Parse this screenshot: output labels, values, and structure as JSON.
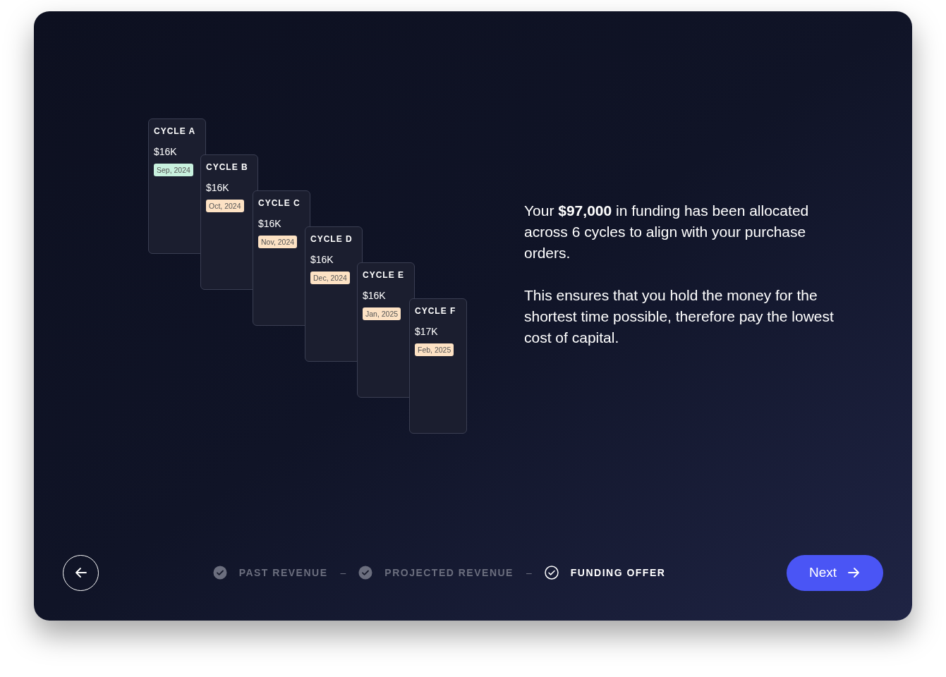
{
  "cycles": [
    {
      "title": "CYCLE A",
      "amount": "$16K",
      "date": "Sep, 2024",
      "color": "#c8f1de"
    },
    {
      "title": "CYCLE B",
      "amount": "$16K",
      "date": "Oct, 2024",
      "color": "#fde2c4"
    },
    {
      "title": "CYCLE C",
      "amount": "$16K",
      "date": "Nov, 2024",
      "color": "#fde2c4"
    },
    {
      "title": "CYCLE D",
      "amount": "$16K",
      "date": "Dec, 2024",
      "color": "#fde2c4"
    },
    {
      "title": "CYCLE E",
      "amount": "$16K",
      "date": "Jan, 2025",
      "color": "#fde2c4"
    },
    {
      "title": "CYCLE F",
      "amount": "$17K",
      "date": "Feb, 2025",
      "color": "#fde2c4"
    }
  ],
  "paragraphs": [
    "Your **$97,000** in funding has been allocated across 6 cycles to align with your purchase orders.",
    "This ensures that you hold the money for the shortest time possible, therefore pay the lowest cost of capital."
  ],
  "steps": [
    {
      "label": "PAST REVENUE",
      "selected": false
    },
    {
      "label": "PROJECTED REVENUE",
      "selected": false
    },
    {
      "label": "FUNDING OFFER",
      "selected": true
    }
  ],
  "separator": "–",
  "next_button": "Next"
}
